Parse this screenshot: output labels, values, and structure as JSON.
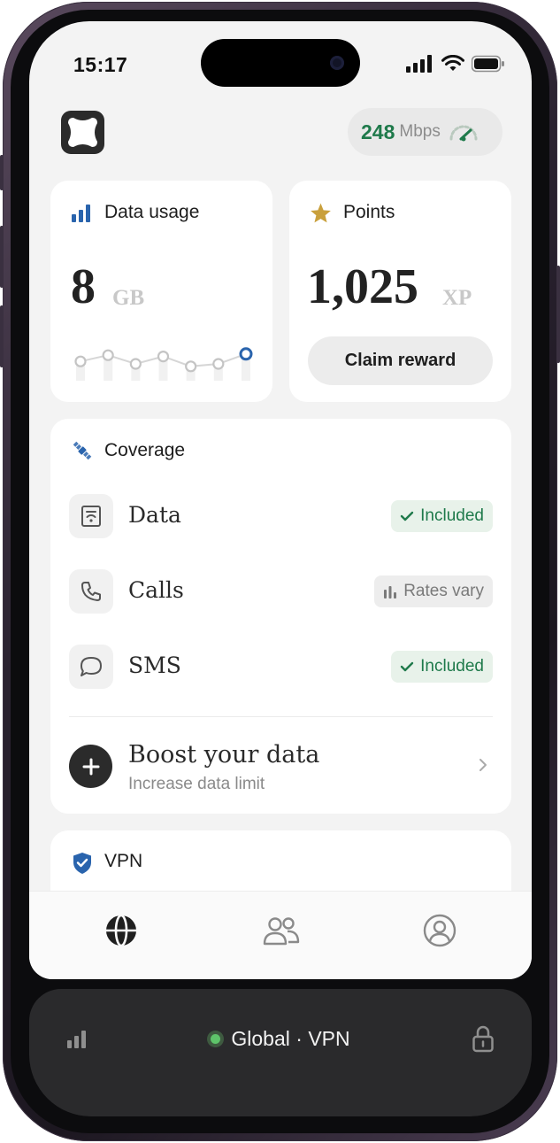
{
  "status_bar": {
    "time": "15:17",
    "icons": [
      "cellular-signal-icon",
      "wifi-icon",
      "battery-icon"
    ]
  },
  "header": {
    "logo_icon": "app-logo-icon",
    "speed_value": "248",
    "speed_unit": "Mbps",
    "speed_icon": "speedometer-icon"
  },
  "data_usage": {
    "title": "Data usage",
    "icon": "bar-chart-icon",
    "value": "8",
    "unit": "GB",
    "sparkline": [
      0.35,
      0.6,
      0.25,
      0.55,
      0.15,
      0.25,
      0.65
    ]
  },
  "points": {
    "title": "Points",
    "icon": "star-icon",
    "value": "1,025",
    "unit": "XP",
    "claim_label": "Claim reward"
  },
  "coverage": {
    "title": "Coverage",
    "icon": "satellite-icon",
    "rows": [
      {
        "label": "Data",
        "icon": "data-sim-icon",
        "badge": "Included",
        "badge_icon": "check-icon",
        "status": "included"
      },
      {
        "label": "Calls",
        "icon": "phone-icon",
        "badge": "Rates vary",
        "badge_icon": "bars-icon",
        "status": "rates"
      },
      {
        "label": "SMS",
        "icon": "message-bubble-icon",
        "badge": "Included",
        "badge_icon": "check-icon",
        "status": "included"
      }
    ],
    "boost": {
      "title": "Boost your data",
      "subtitle": "Increase data limit",
      "icon": "plus-icon"
    }
  },
  "vpn_card": {
    "title": "VPN",
    "icon": "shield-check-icon"
  },
  "bottom_nav": {
    "items": [
      {
        "id": "globe",
        "icon": "globe-icon",
        "active": true
      },
      {
        "id": "people",
        "icon": "people-icon",
        "active": false
      },
      {
        "id": "profile",
        "icon": "profile-icon",
        "active": false
      }
    ]
  },
  "vpn_bar": {
    "label": "Global · VPN",
    "status_color": "#5ec46a",
    "left_icon": "signal-bars-icon",
    "right_icon": "lock-icon"
  },
  "colors": {
    "accent_green": "#1f7a4b",
    "accent_blue": "#2a64ad",
    "star_gold": "#c9a03c",
    "background": "#f3f3f3"
  }
}
